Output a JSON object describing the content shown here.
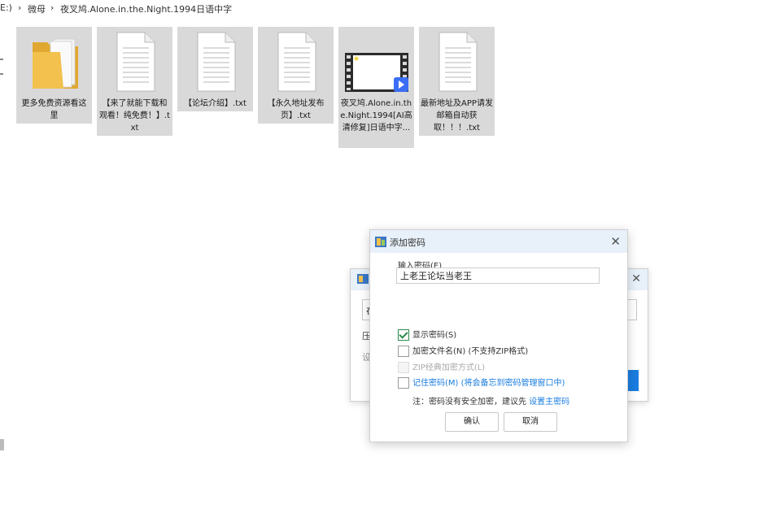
{
  "breadcrumb": {
    "drive": "E:)",
    "sep1": "›",
    "folder": "微母",
    "sep2": "›",
    "current": "夜叉鸠.Alone.in.the.Night.1994日语中字"
  },
  "files": [
    {
      "type": "folder",
      "label": "更多免费资源看这里"
    },
    {
      "type": "txt",
      "label": "【来了就能下载和观看！纯免费！】.txt"
    },
    {
      "type": "txt",
      "label": "【论坛介绍】.txt"
    },
    {
      "type": "txt",
      "label": "【永久地址发布页】.txt"
    },
    {
      "type": "video",
      "label": "夜叉鸠.Alone.in.the.Night.1994[AI高清修复]日语中字...",
      "selected": true
    },
    {
      "type": "txt",
      "label": "最新地址及APP请发邮箱自动获取！！！.txt"
    }
  ],
  "dialog": {
    "title": "添加密码",
    "password_label": "输入密码(E)",
    "password_value": "上老王论坛当老王",
    "options": [
      {
        "label": "显示密码(S)",
        "checked": true,
        "disabled": false,
        "blue": false
      },
      {
        "label": "加密文件名(N) (不支持ZIP格式)",
        "checked": false,
        "disabled": false,
        "blue": false
      },
      {
        "label": "ZIP经典加密方式(L)",
        "checked": false,
        "disabled": true,
        "blue": false
      },
      {
        "label": "记住密码(M) (将会备忘到密码管理窗口中)",
        "checked": false,
        "disabled": false,
        "blue": true
      }
    ],
    "note": "注：密码没有安全加密，建议先",
    "note_link": "设置主密码",
    "ok": "确认",
    "cancel": "取消",
    "close": "✕"
  },
  "bg_dialog": {
    "close": "✕",
    "field_char": "在",
    "label1": "压",
    "label2": "设"
  },
  "colors": {
    "accent": "#1a7de0",
    "titlebar": "#e8f0fa",
    "tile_selected": "#d9d9d9",
    "check_green": "#2a8a4a"
  }
}
